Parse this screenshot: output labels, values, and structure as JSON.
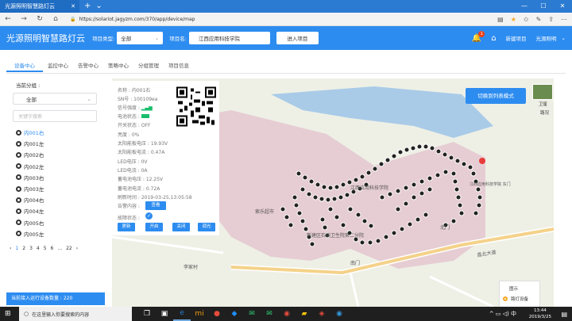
{
  "browser": {
    "tab_title": "光源照明智慧路灯云",
    "url": "https://solariot.jagyzm.com/370/app/device/map"
  },
  "header": {
    "app_title": "光源照明智慧路灯云",
    "project_type_label": "项目类型:",
    "project_type_value": "全部",
    "project_name_label": "项目名:",
    "project_name_value": "江西应用科技学院",
    "enter_button": "进入项目",
    "notify_count": "1",
    "new_project": "新建项目",
    "user": "光源照明"
  },
  "tabs": [
    "设备中心",
    "监控中心",
    "告警中心",
    "策略中心",
    "分组管理",
    "项目信息"
  ],
  "left": {
    "group_label": "当前分组 :",
    "group_value": "全部",
    "search_placeholder": "关键字搜索",
    "devices": [
      "内001右",
      "内001左",
      "内002右",
      "内002左",
      "内003右",
      "内003左",
      "内004右",
      "内004左",
      "内005右",
      "内005左"
    ],
    "pager": [
      "‹",
      "1",
      "2",
      "3",
      "4",
      "5",
      "6",
      "...",
      "22",
      "›"
    ],
    "count_text": "当前接入运行设备数量 : 220"
  },
  "info": {
    "name": "名称 : 内001右",
    "sn": "SN号 : 100109ea",
    "signal": "信号强度 :",
    "battery": "电池状态 :",
    "switch": "开关状态 : OFF",
    "brightness": "亮度 : 0%",
    "solar_v": "太阳能板电压 : 19.93V",
    "solar_i": "太阳能板电流 : 0.47A",
    "led_v": "LED电压 : 0V",
    "led_i": "LED电流 : 0A",
    "bat_v": "蓄电池电压 : 12.25V",
    "bat_i": "蓄电池电流 : 0.72A",
    "refresh_time": "刷新时间 : 2019-03-25,13:05:58",
    "alarm_label": "告警内容 :",
    "view_button": "查看",
    "fault_label": "故障状态 :",
    "buttons": [
      "更新",
      "开启",
      "关闭",
      "调光"
    ]
  },
  "map": {
    "mode_button": "切换到列表模式",
    "satellite": "卫星",
    "traffic": "路况",
    "labels": [
      "索乐超市",
      "新建区石岗卫生院第二分院",
      "南门",
      "江西应用科技学院",
      "昌北大道",
      "李家村",
      "北门",
      "江西应用科技学院 东门"
    ],
    "legend_title": "图示",
    "legend_item": "路灯设备"
  },
  "taskbar": {
    "search": "在这里输入你要搜索的内容",
    "time": "13:44",
    "date": "2019/3/25"
  }
}
